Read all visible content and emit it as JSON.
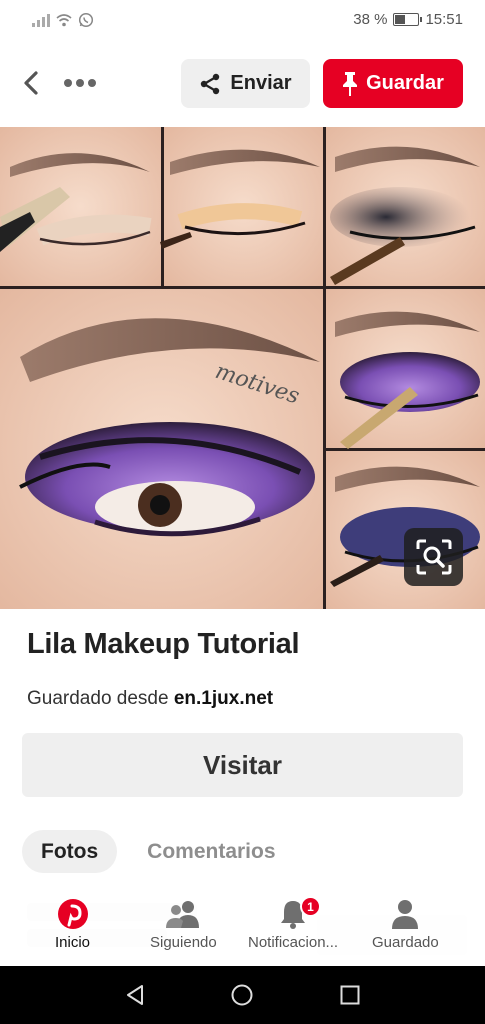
{
  "status_bar": {
    "battery_text": "38 %",
    "battery_level": 0.38,
    "time": "15:51",
    "icons": [
      "signal-icon",
      "wifi-icon",
      "whatsapp-icon",
      "battery-icon"
    ]
  },
  "toolbar": {
    "back_icon": "chevron-left-icon",
    "more_icon": "ellipsis-icon",
    "share_label": "Enviar",
    "save_label": "Guardar"
  },
  "pin": {
    "image_text": "motives",
    "title": "Lila Makeup Tutorial",
    "saved_from_prefix": "Guardado desde",
    "saved_from_source": "en.1jux.net",
    "visit_label": "Visitar"
  },
  "tabs": [
    {
      "label": "Fotos",
      "active": true
    },
    {
      "label": "Comentarios",
      "active": false
    }
  ],
  "bottom_nav": [
    {
      "label": "Inicio",
      "icon": "pinterest-icon",
      "active": true
    },
    {
      "label": "Siguiendo",
      "icon": "people-icon",
      "active": false
    },
    {
      "label": "Notificacion...",
      "icon": "bell-icon",
      "active": false,
      "badge": "1"
    },
    {
      "label": "Guardado",
      "icon": "person-icon",
      "active": false
    }
  ],
  "colors": {
    "brand_red": "#e60023",
    "button_gray": "#efefef",
    "eyeshadow_purple": "#7a4fb3"
  }
}
